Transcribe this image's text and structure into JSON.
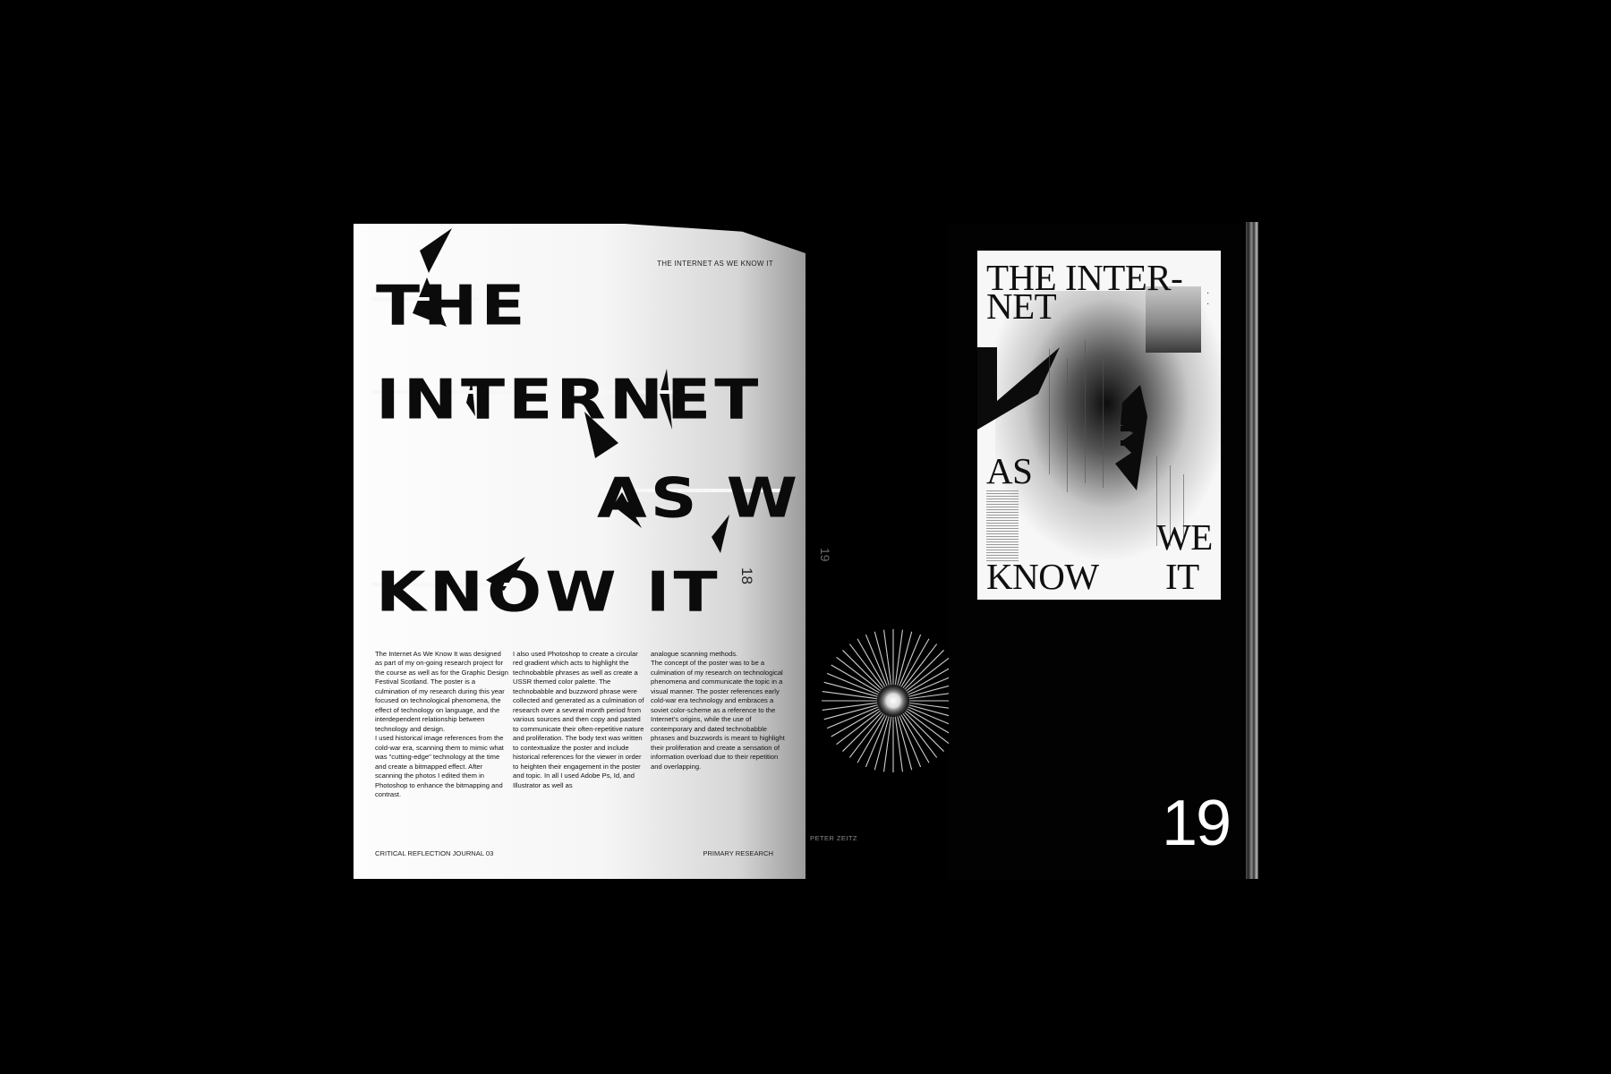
{
  "left_page": {
    "running_head": "THE INTERNET AS WE KNOW IT",
    "page_number": "18",
    "title_lines": [
      "THE",
      "INTERNET",
      "AS WE",
      "KNOW IT"
    ],
    "body_columns": [
      "The Internet As We Know It was designed as part of my on-going research project for the course as well as for the Graphic Design Festival Scotland. The poster is a culmination of my research during this year focused on technological phenomena, the effect of technology on language, and the interdependent relationship between technology and design.\nI used historical image references from the cold-war era, scanning them to mimic what was \"cutting-edge\" technology at the time and create a bitmapped effect. After scanning the photos I edited them in Photoshop to enhance the bitmapping and contrast.",
      "I also used Photoshop to create a circular red gradient which acts to highlight the technobabble phrases as well as create a USSR themed color palette. The technobabble and buzzword phrase were collected and generated as a culmination of research over a several month period from various sources and then copy and pasted to communicate their often-repetitive nature and proliferation. The body text was written to contextualize the poster and include historical references for the viewer in order to heighten their engagement in the poster and topic. In all I used Adobe Ps, Id, and Illustrator as well as",
      "analogue scanning methods.\nThe concept of the poster was to be a culmination of my research on technological phenomena and communicate the topic in a visual manner. The poster references early cold-war era technology and embraces a soviet color-scheme as a reference to the Internet's origins, while the use of contemporary and dated technobabble phrases and buzzwords is meant to highlight their proliferation and create a sensation of information overload due to their repetition and overlapping."
    ],
    "footer_left": "CRITICAL REFLECTION JOURNAL 03",
    "footer_right": "PRIMARY RESEARCH"
  },
  "dark_page": {
    "page_number": "19",
    "author_credit": "PETER ZEITZ"
  },
  "poster": {
    "line1": "THE INTER-",
    "line2": "NET",
    "word_as": "AS",
    "word_we": "WE",
    "word_know": "KNOW",
    "word_it": "IT"
  },
  "right_page": {
    "big_number": "19"
  },
  "colors": {
    "background": "#000000",
    "paper": "#f7f7f7",
    "ink": "#0b0b0b"
  }
}
